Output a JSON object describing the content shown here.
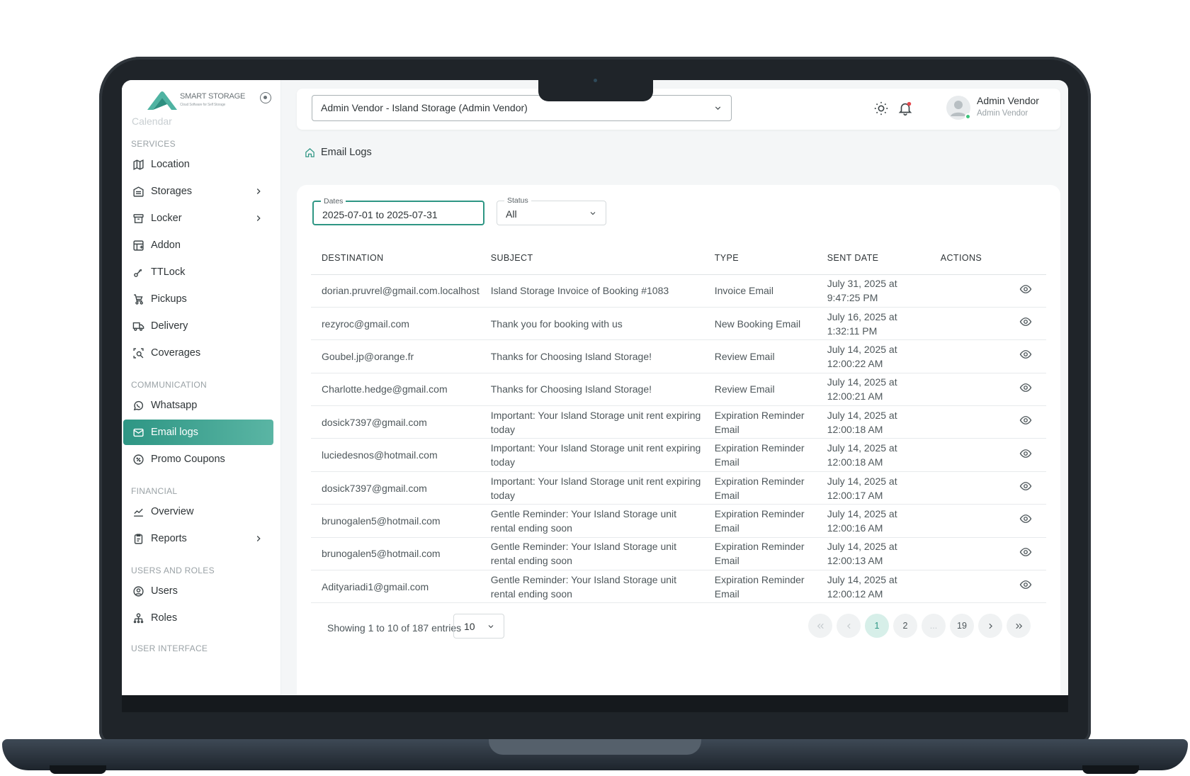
{
  "app": {
    "logo_text": "SMART STORAGE",
    "logo_sub": "Cloud Software for Self Storage"
  },
  "sidebar": {
    "faded_item": "Calendar",
    "sections": {
      "services": "SERVICES",
      "communication": "COMMUNICATION",
      "financial": "FINANCIAL",
      "users_roles": "USERS AND ROLES",
      "user_interface": "USER INTERFACE"
    },
    "items": {
      "location": "Location",
      "storages": "Storages",
      "locker": "Locker",
      "addon": "Addon",
      "ttlock": "TTLock",
      "pickups": "Pickups",
      "delivery": "Delivery",
      "coverages": "Coverages",
      "whatsapp": "Whatsapp",
      "email_logs": "Email logs",
      "promo": "Promo Coupons",
      "overview": "Overview",
      "reports": "Reports",
      "users": "Users",
      "roles": "Roles"
    }
  },
  "topbar": {
    "vendor": "Admin Vendor - Island Storage (Admin Vendor)",
    "user_name": "Admin Vendor",
    "user_role": "Admin Vendor"
  },
  "breadcrumb": {
    "current": "Email Logs"
  },
  "filters": {
    "dates_label": "Dates",
    "dates_value": "2025-07-01 to 2025-07-31",
    "status_label": "Status",
    "status_value": "All"
  },
  "table": {
    "headers": {
      "destination": "DESTINATION",
      "subject": "SUBJECT",
      "type": "TYPE",
      "sent": "SENT DATE",
      "actions": "ACTIONS"
    },
    "rows": [
      {
        "destination": "dorian.pruvrel@gmail.com.localhost",
        "subject": "Island Storage Invoice of Booking #1083",
        "type": "Invoice Email",
        "sent": "July 31, 2025 at 9:47:25 PM"
      },
      {
        "destination": "rezyroc@gmail.com",
        "subject": "Thank you for booking with us",
        "type": "New Booking Email",
        "sent": "July 16, 2025 at 1:32:11 PM"
      },
      {
        "destination": "Goubel.jp@orange.fr",
        "subject": "Thanks for Choosing Island Storage!",
        "type": "Review Email",
        "sent": "July 14, 2025 at 12:00:22 AM"
      },
      {
        "destination": "Charlotte.hedge@gmail.com",
        "subject": "Thanks for Choosing Island Storage!",
        "type": "Review Email",
        "sent": "July 14, 2025 at 12:00:21 AM"
      },
      {
        "destination": "dosick7397@gmail.com",
        "subject": "Important: Your Island Storage unit rent expiring today",
        "type": "Expiration Reminder Email",
        "sent": "July 14, 2025 at 12:00:18 AM"
      },
      {
        "destination": "luciedesnos@hotmail.com",
        "subject": "Important: Your Island Storage unit rent expiring today",
        "type": "Expiration Reminder Email",
        "sent": "July 14, 2025 at 12:00:18 AM"
      },
      {
        "destination": "dosick7397@gmail.com",
        "subject": "Important: Your Island Storage unit rent expiring today",
        "type": "Expiration Reminder Email",
        "sent": "July 14, 2025 at 12:00:17 AM"
      },
      {
        "destination": "brunogalen5@hotmail.com",
        "subject": "Gentle Reminder: Your Island Storage unit rental ending soon",
        "type": "Expiration Reminder Email",
        "sent": "July 14, 2025 at 12:00:16 AM"
      },
      {
        "destination": "brunogalen5@hotmail.com",
        "subject": "Gentle Reminder: Your Island Storage unit rental ending soon",
        "type": "Expiration Reminder Email",
        "sent": "July 14, 2025 at 12:00:13 AM"
      },
      {
        "destination": "Adityariadi1@gmail.com",
        "subject": "Gentle Reminder: Your Island Storage unit rental ending soon",
        "type": "Expiration Reminder Email",
        "sent": "July 14, 2025 at 12:00:12 AM"
      }
    ]
  },
  "footer": {
    "showing": "Showing 1 to 10 of 187 entries",
    "per_page": "10",
    "pages": {
      "p1": "1",
      "p2": "2",
      "ellipsis": "...",
      "last": "19"
    }
  },
  "colors": {
    "accent": "#2e9684",
    "accent_light": "#5ab5a4",
    "frame": "#1f2429"
  }
}
